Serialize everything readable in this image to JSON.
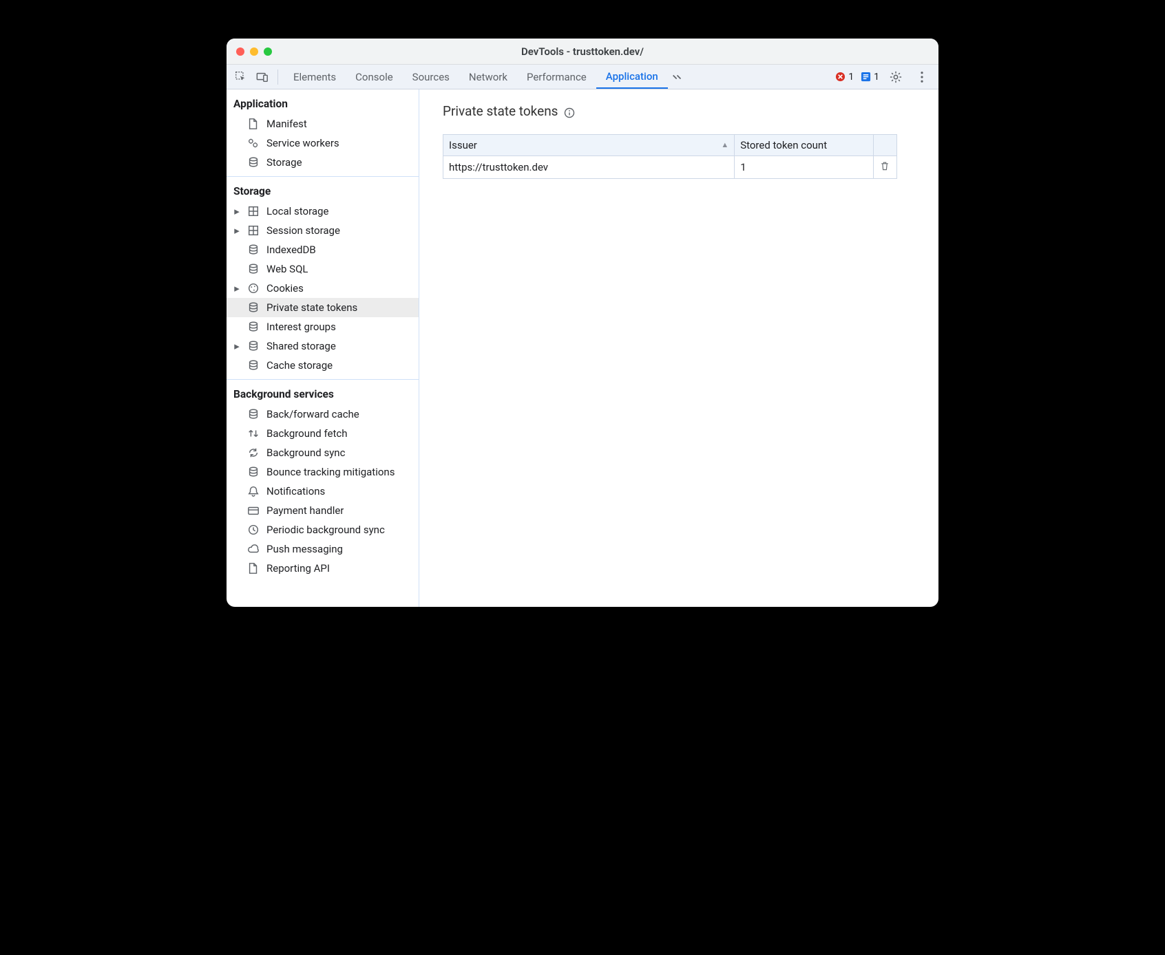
{
  "window": {
    "title": "DevTools - trusttoken.dev/"
  },
  "toolbar": {
    "tabs": [
      "Elements",
      "Console",
      "Sources",
      "Network",
      "Performance",
      "Application"
    ],
    "active_tab": "Application",
    "errors_count": "1",
    "issues_count": "1"
  },
  "sidebar": {
    "sections": [
      {
        "title": "Application",
        "items": [
          {
            "label": "Manifest",
            "icon": "file-icon"
          },
          {
            "label": "Service workers",
            "icon": "gears-icon"
          },
          {
            "label": "Storage",
            "icon": "storage-icon"
          }
        ]
      },
      {
        "title": "Storage",
        "items": [
          {
            "label": "Local storage",
            "icon": "grid-icon",
            "expandable": true
          },
          {
            "label": "Session storage",
            "icon": "grid-icon",
            "expandable": true
          },
          {
            "label": "IndexedDB",
            "icon": "storage-icon"
          },
          {
            "label": "Web SQL",
            "icon": "storage-icon"
          },
          {
            "label": "Cookies",
            "icon": "cookie-icon",
            "expandable": true
          },
          {
            "label": "Private state tokens",
            "icon": "storage-icon",
            "selected": true
          },
          {
            "label": "Interest groups",
            "icon": "storage-icon"
          },
          {
            "label": "Shared storage",
            "icon": "storage-icon",
            "expandable": true
          },
          {
            "label": "Cache storage",
            "icon": "storage-icon"
          }
        ]
      },
      {
        "title": "Background services",
        "items": [
          {
            "label": "Back/forward cache",
            "icon": "storage-icon"
          },
          {
            "label": "Background fetch",
            "icon": "updown-icon"
          },
          {
            "label": "Background sync",
            "icon": "sync-icon"
          },
          {
            "label": "Bounce tracking mitigations",
            "icon": "storage-icon"
          },
          {
            "label": "Notifications",
            "icon": "bell-icon"
          },
          {
            "label": "Payment handler",
            "icon": "card-icon"
          },
          {
            "label": "Periodic background sync",
            "icon": "clock-icon"
          },
          {
            "label": "Push messaging",
            "icon": "cloud-icon"
          },
          {
            "label": "Reporting API",
            "icon": "file-icon"
          }
        ]
      }
    ]
  },
  "main": {
    "title": "Private state tokens",
    "columns": {
      "issuer": "Issuer",
      "count": "Stored token count"
    },
    "rows": [
      {
        "issuer": "https://trusttoken.dev",
        "count": "1"
      }
    ]
  }
}
